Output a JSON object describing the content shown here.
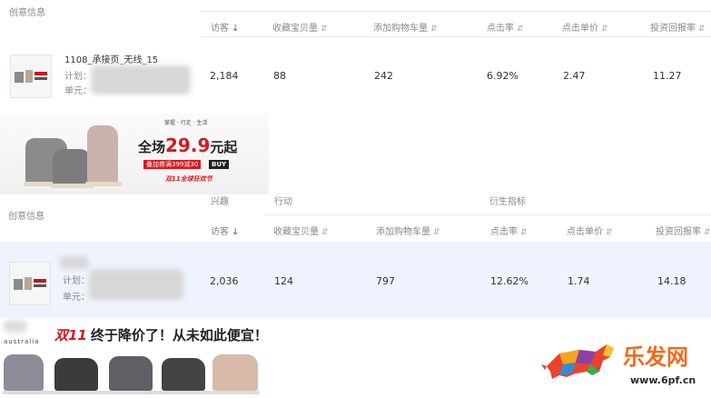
{
  "section1": {
    "creative_label": "创意信息",
    "columns": [
      {
        "label": "访客",
        "sort": "↓"
      },
      {
        "label": "收藏宝贝量",
        "sort": "⇵"
      },
      {
        "label": "添加购物车量",
        "sort": "⇵"
      },
      {
        "label": "点击率",
        "sort": "⇵"
      },
      {
        "label": "点击单价",
        "sort": "⇵"
      },
      {
        "label": "投资回报率",
        "sort": "⇵"
      }
    ],
    "row": {
      "name": "1108_承接页_无线_15",
      "plan_label": "计划：",
      "unit_label": "单元：",
      "values": [
        "2,184",
        "88",
        "242",
        "6.92%",
        "2.47",
        "11.27"
      ]
    }
  },
  "banner1": {
    "top_text": "掌握 · 行走 · 生活",
    "headline_prefix": "全场",
    "price": "29.9",
    "headline_suffix": "元起",
    "coupon": "叠加券满399减30",
    "buy": "BUY",
    "event": "双11全球狂欢节"
  },
  "section2": {
    "creative_label": "创意信息",
    "groups": [
      {
        "label": "兴趣"
      },
      {
        "label": "行动"
      },
      {
        "label": "衍生指标"
      }
    ],
    "columns": [
      {
        "label": "访客",
        "sort": "↓"
      },
      {
        "label": "收藏宝贝量",
        "sort": "⇵"
      },
      {
        "label": "添加购物车量",
        "sort": "⇵"
      },
      {
        "label": "点击率",
        "sort": "⇵"
      },
      {
        "label": "点击单价",
        "sort": "⇵"
      },
      {
        "label": "投资回报率",
        "sort": "⇵"
      }
    ],
    "row": {
      "plan_label": "计划：",
      "unit_label": "单元：",
      "values": [
        "2,036",
        "124",
        "797",
        "12.62%",
        "1.74",
        "14.18"
      ]
    }
  },
  "banner2": {
    "brand": "australia",
    "headline_red": "双11",
    "headline_black": "终于降价了！从未如此便宜！"
  },
  "watermark": {
    "site_name": "乐发网",
    "url": "www.6pf.cn"
  },
  "colors": {
    "accent_red": "#d71920",
    "row_highlight": "#eef3fd",
    "watermark_orange": "#f06a1a"
  }
}
